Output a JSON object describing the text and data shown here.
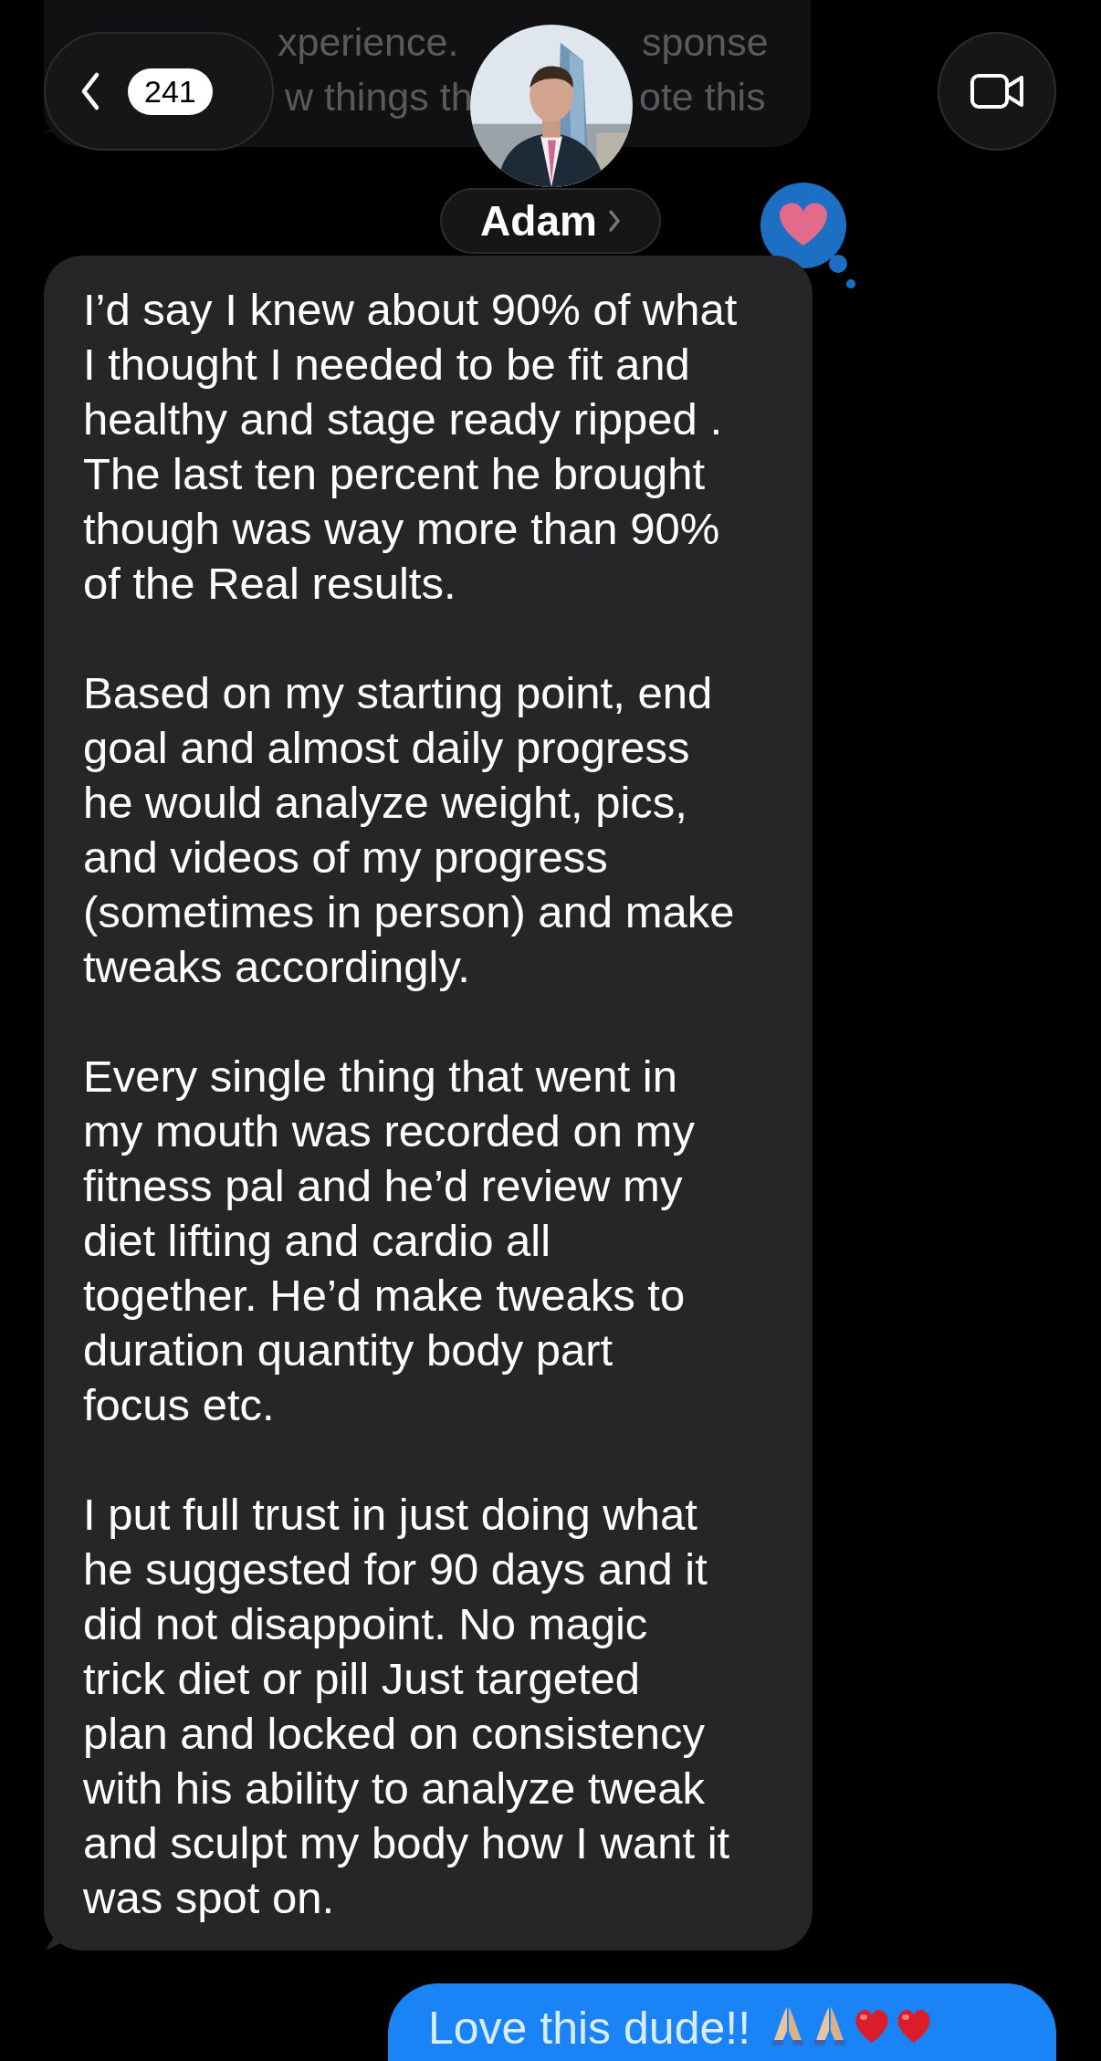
{
  "previous_message": {
    "lines": [
      [
        "xperience.",
        "sponse"
      ],
      [
        "w things th",
        "ote this"
      ]
    ]
  },
  "header": {
    "unread_count": "241",
    "contact_name": "Adam"
  },
  "reaction": {
    "kind": "heart"
  },
  "messages": [
    {
      "kind": "received",
      "paragraphs": [
        "I’d say I knew about 90% of what\nI thought I needed to be fit and\nhealthy and stage ready ripped .\nThe last ten percent he brought\nthough was way more than 90%\nof the Real results.",
        "Based on my starting point, end\ngoal and almost daily progress\nhe would analyze weight, pics,\nand videos of my progress\n(sometimes in person) and make\ntweaks accordingly.",
        "Every single thing that went in\nmy mouth was recorded on my\nfitness pal and he’d review my\ndiet lifting and cardio all\ntogether. He’d make tweaks to\nduration quantity body part\nfocus etc.",
        "I put full trust in just doing what\nhe suggested for 90 days and it\ndid not disappoint. No magic\ntrick diet or pill Just targeted\nplan and locked on consistency\nwith his ability to analyze tweak\nand sculpt my body how I want it\nwas spot on."
      ]
    },
    {
      "kind": "sent",
      "text": "Love this dude!!",
      "emoji": [
        {
          "kind": "praying-hands"
        },
        {
          "kind": "praying-hands"
        },
        {
          "kind": "heart"
        },
        {
          "kind": "heart"
        }
      ]
    }
  ]
}
